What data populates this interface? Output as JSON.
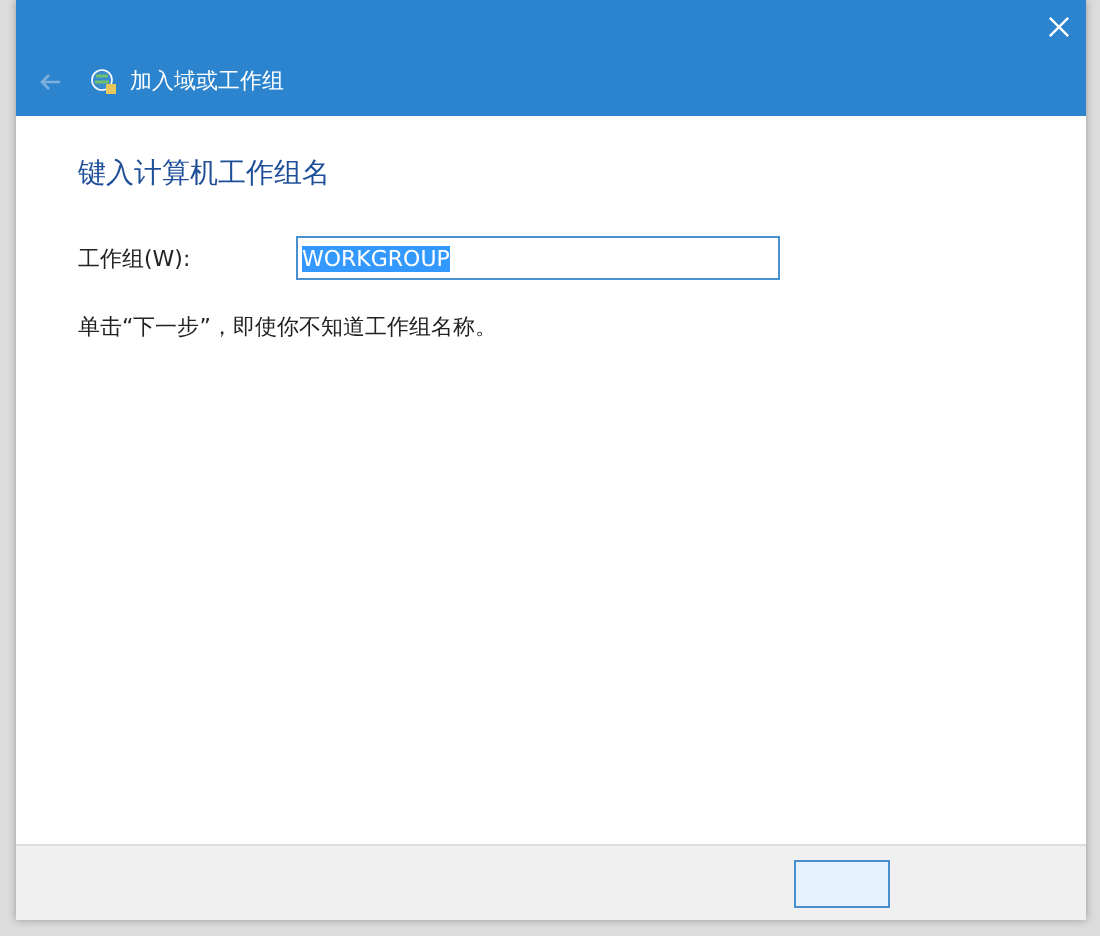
{
  "dialog": {
    "title": "加入域或工作组",
    "heading": "键入计算机工作组名",
    "field": {
      "label": "工作组(W):",
      "value": "WORKGROUP",
      "selected": true
    },
    "hint": "单击“下一步”，即使你不知道工作组名称。"
  }
}
